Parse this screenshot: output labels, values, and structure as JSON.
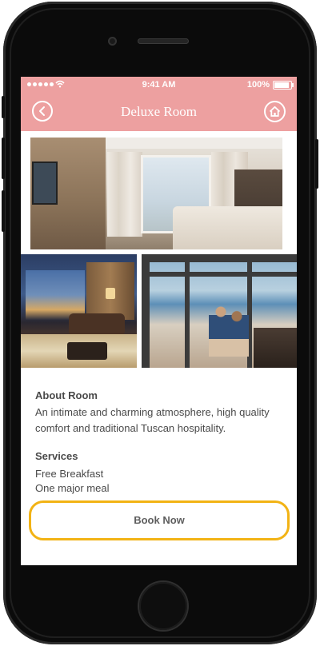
{
  "status_bar": {
    "time": "9:41 AM",
    "battery": "100%"
  },
  "header": {
    "title": "Deluxe Room"
  },
  "icons": [
    "chevron-left-icon",
    "home-icon",
    "wifi-icon",
    "signal-dots-icon",
    "battery-icon",
    "bluetooth-icon"
  ],
  "colors": {
    "header_bg": "#eda0a0",
    "accent_outline": "#f2b315",
    "text": "#4a4a4a",
    "phone_body": "#0b0b0b"
  },
  "about": {
    "heading": "About Room",
    "text": "An intimate and charming atmosphere, high quality comfort and traditional Tuscan hospitality."
  },
  "services": {
    "heading": "Services",
    "items": [
      "Free Breakfast",
      "One major meal"
    ]
  },
  "cta": {
    "label": "Book Now"
  }
}
